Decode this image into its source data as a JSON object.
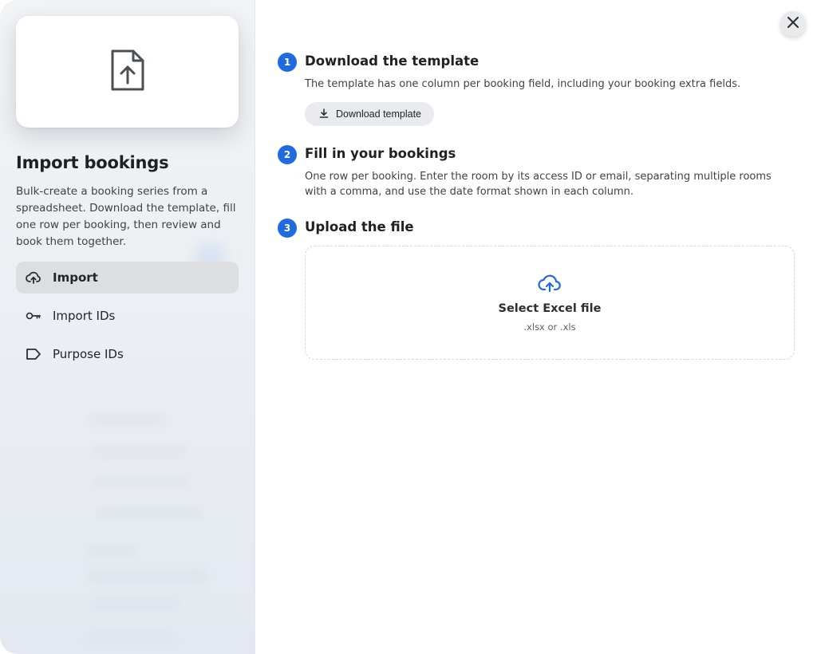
{
  "sidebar": {
    "preview_icon": "file-upload-icon",
    "title": "Import bookings",
    "description": "Bulk-create a booking series from a spreadsheet. Download the template, fill one row per booking, then review and book them together.",
    "items": [
      {
        "label": "Import",
        "icon": "cloud-upload-icon",
        "active": true
      },
      {
        "label": "Import IDs",
        "icon": "key-icon",
        "active": false
      },
      {
        "label": "Purpose IDs",
        "icon": "tag-icon",
        "active": false
      }
    ]
  },
  "close": {
    "icon": "close-icon"
  },
  "steps": [
    {
      "number": "1",
      "title": "Download the template",
      "description": "The template has one column per booking field, including your booking extra fields.",
      "button_label": "Download template",
      "button_icon": "download-icon"
    },
    {
      "number": "2",
      "title": "Fill in your bookings",
      "description": "One row per booking. Enter the room by its access ID or email, separating multiple rooms with a comma, and use the date format shown in each column."
    },
    {
      "number": "3",
      "title": "Upload the file",
      "dropzone": {
        "icon": "cloud-upload-icon",
        "label": "Select Excel file",
        "sub": ".xlsx or .xls"
      }
    }
  ],
  "colors": {
    "accent": "#1f6ae0",
    "active_nav_bg": "#dcdee2"
  }
}
